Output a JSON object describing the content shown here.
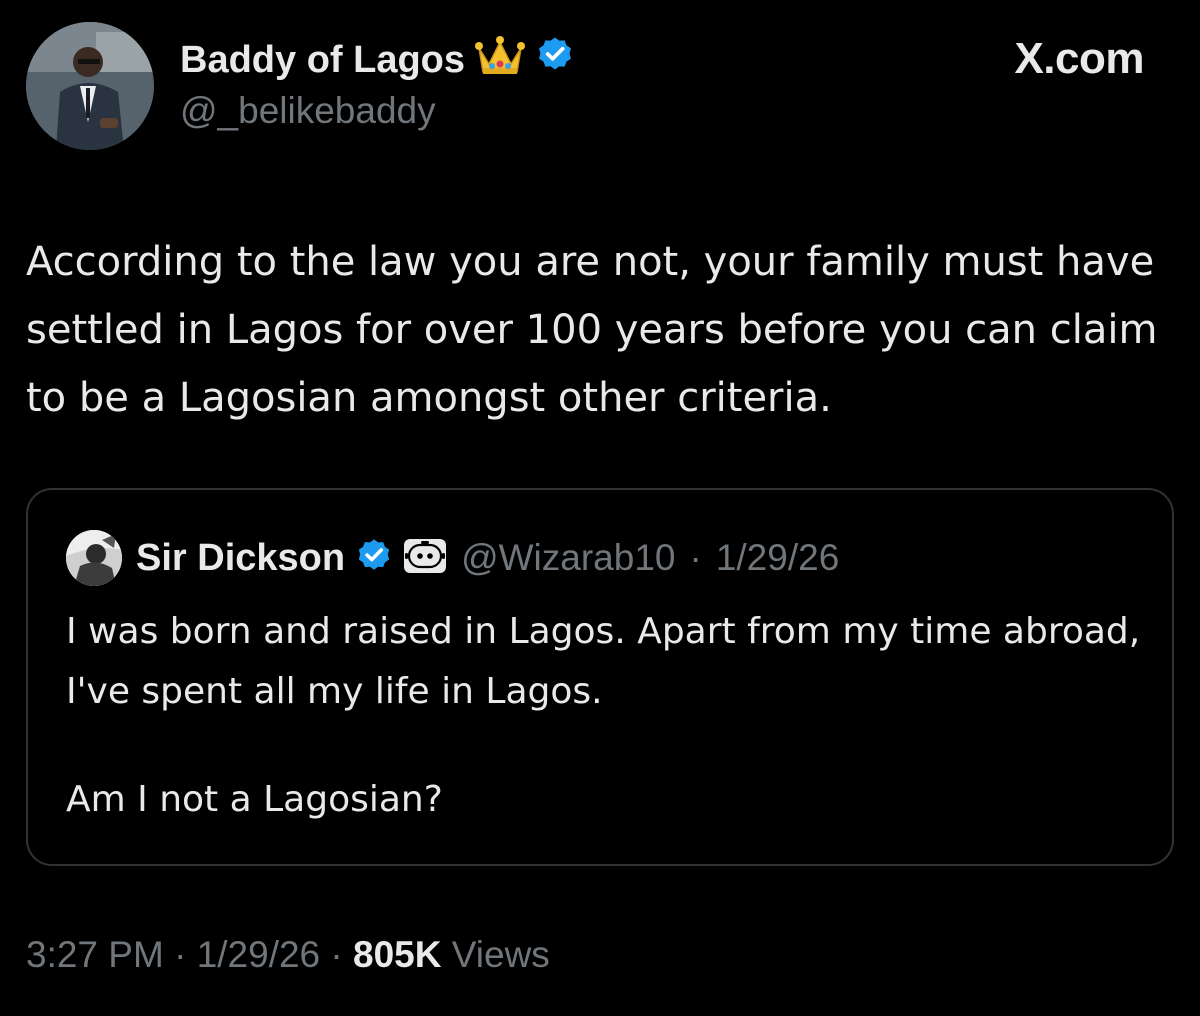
{
  "header": {
    "display_name": "Baddy of Lagos",
    "handle": "@_belikebaddy",
    "site_label": "X.com",
    "icons": [
      "crown-emoji-icon",
      "verified-badge-icon"
    ]
  },
  "tweet": {
    "text": "According to the law you are not, your family must have settled in Lagos for over 100 years before you can claim to be a Lagosian amongst other criteria."
  },
  "quote": {
    "display_name": "Sir Dickson",
    "handle": "@Wizarab10",
    "separator": "·",
    "date": "1/29/26",
    "text_line1": "I was born and raised in Lagos. Apart from my time abroad, I've spent all my life in Lagos.",
    "text_line2": "Am I not a Lagosian?",
    "icons": [
      "verified-badge-icon",
      "automated-bot-icon"
    ]
  },
  "footer": {
    "time": "3:27 PM",
    "sep1": "·",
    "date": "1/29/26",
    "sep2": "·",
    "views_count": "805K",
    "views_label": "Views"
  },
  "colors": {
    "background": "#000000",
    "primary_text": "#e7e9ea",
    "secondary_text": "#71767b",
    "border": "#2f3336",
    "verified_blue": "#1d9bf0"
  }
}
